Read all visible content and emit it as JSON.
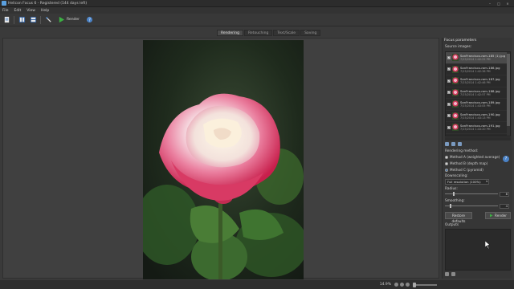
{
  "window": {
    "title": "Helicon Focus 6 - Registered (144 days left)",
    "controls": [
      "–",
      "□",
      "×"
    ]
  },
  "menu": [
    "File",
    "Edit",
    "View",
    "Help"
  ],
  "toolbar": {
    "render_label": "Render"
  },
  "tabs": [
    {
      "label": "Rendering",
      "active": true
    },
    {
      "label": "Retouching",
      "active": false
    },
    {
      "label": "Text/Scale",
      "active": false
    },
    {
      "label": "Saving",
      "active": false
    }
  ],
  "panel": {
    "title": "Focus parameters",
    "source_label": "Source images:",
    "sources": [
      {
        "name": "SanFrancisco-rom-185 (1).jpg",
        "date": "7/15/2014 1:42:22 PM",
        "checked": true
      },
      {
        "name": "SanFrancisco-rom-186.jpg",
        "date": "7/15/2014 1:42:36 PM",
        "checked": true
      },
      {
        "name": "SanFrancisco-rom-187.jpg",
        "date": "7/15/2014 1:42:46 PM",
        "checked": true
      },
      {
        "name": "SanFrancisco-rom-188.jpg",
        "date": "7/15/2014 1:42:57 PM",
        "checked": true
      },
      {
        "name": "SanFrancisco-rom-189.jpg",
        "date": "7/15/2014 1:43:05 PM",
        "checked": true
      },
      {
        "name": "SanFrancisco-rom-190.jpg",
        "date": "7/15/2014 1:43:13 PM",
        "checked": true
      },
      {
        "name": "SanFrancisco-rom-191.jpg",
        "date": "7/15/2014 1:43:20 PM",
        "checked": true
      }
    ],
    "rendering_method_label": "Rendering method:",
    "methods": [
      {
        "label": "Method A (weighted average)",
        "selected": false
      },
      {
        "label": "Method B (depth map)",
        "selected": false
      },
      {
        "label": "Method C (pyramid)",
        "selected": true
      }
    ],
    "downscaling_label": "Downscaling:",
    "downscaling_value": "Full resolution (100%)",
    "radius_label": "Radius:",
    "radius_value": "8",
    "smoothing_label": "Smoothing:",
    "smoothing_value": "4",
    "restore_label": "Restore defaults",
    "render_label": "Render",
    "outputs_label": "Outputs"
  },
  "status": {
    "zoom": "14.9%"
  },
  "colors": {
    "accent": "#4a82c6",
    "render_green": "#3cb043"
  }
}
